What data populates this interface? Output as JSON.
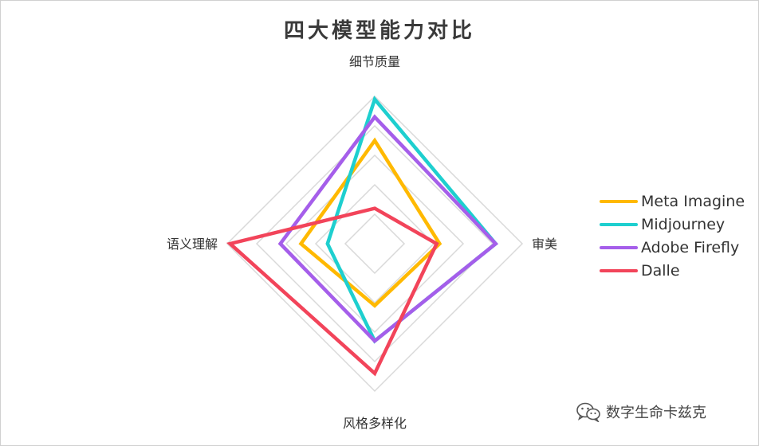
{
  "chart_data": {
    "type": "radar",
    "title": "四大模型能力对比",
    "axes": [
      "细节质量",
      "审美",
      "风格多样化",
      "语义理解"
    ],
    "range": [
      0,
      5
    ],
    "rings": 5,
    "series": [
      {
        "name": "Meta Imagine",
        "color": "#FFB900",
        "values": [
          3.5,
          2.2,
          2.1,
          2.5
        ]
      },
      {
        "name": "Midjourney",
        "color": "#1ECFCF",
        "values": [
          4.9,
          4.1,
          3.3,
          1.6
        ]
      },
      {
        "name": "Adobe Firefly",
        "color": "#A55EEA",
        "values": [
          4.3,
          4.1,
          3.3,
          3.2
        ]
      },
      {
        "name": "Dalle",
        "color": "#F2445A",
        "values": [
          1.2,
          2.1,
          4.4,
          4.9
        ]
      }
    ]
  },
  "watermark": {
    "text": "数字生命卡兹克",
    "icon": "wechat-icon"
  }
}
